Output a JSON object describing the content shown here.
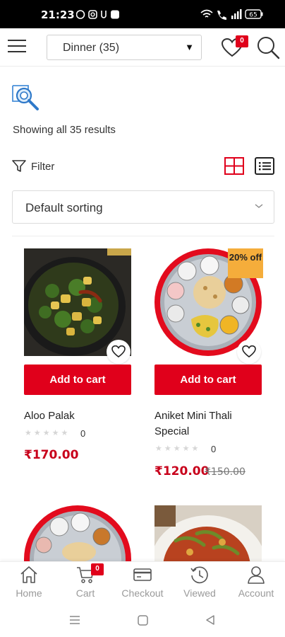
{
  "status_bar": {
    "time": "21:23",
    "battery": "65"
  },
  "app_bar": {
    "category_select": "Dinner  (35)",
    "wishlist_count": "0"
  },
  "results_text": "Showing all 35 results",
  "filter_label": "Filter",
  "sorting": {
    "selected": "Default sorting"
  },
  "products": [
    {
      "name": "Aloo Palak",
      "rating_count": "0",
      "price": "₹170.00",
      "button": "Add to cart",
      "stars": "★★★★★"
    },
    {
      "name": "Aniket Mini Thali Special",
      "rating_count": "0",
      "price": "₹120.00",
      "old_price": "₹150.00",
      "sale_badge": "20% off",
      "button": "Add to cart",
      "stars": "★★★★★"
    }
  ],
  "bottom_nav": [
    {
      "label": "Home",
      "icon": "home-icon"
    },
    {
      "label": "Cart",
      "icon": "cart-icon",
      "badge": "0"
    },
    {
      "label": "Checkout",
      "icon": "credit-card-icon"
    },
    {
      "label": "Viewed",
      "icon": "history-icon"
    },
    {
      "label": "Account",
      "icon": "user-icon"
    }
  ],
  "colors": {
    "accent": "#e0001b",
    "sale": "#f5ad3b",
    "price": "#c8001b"
  }
}
